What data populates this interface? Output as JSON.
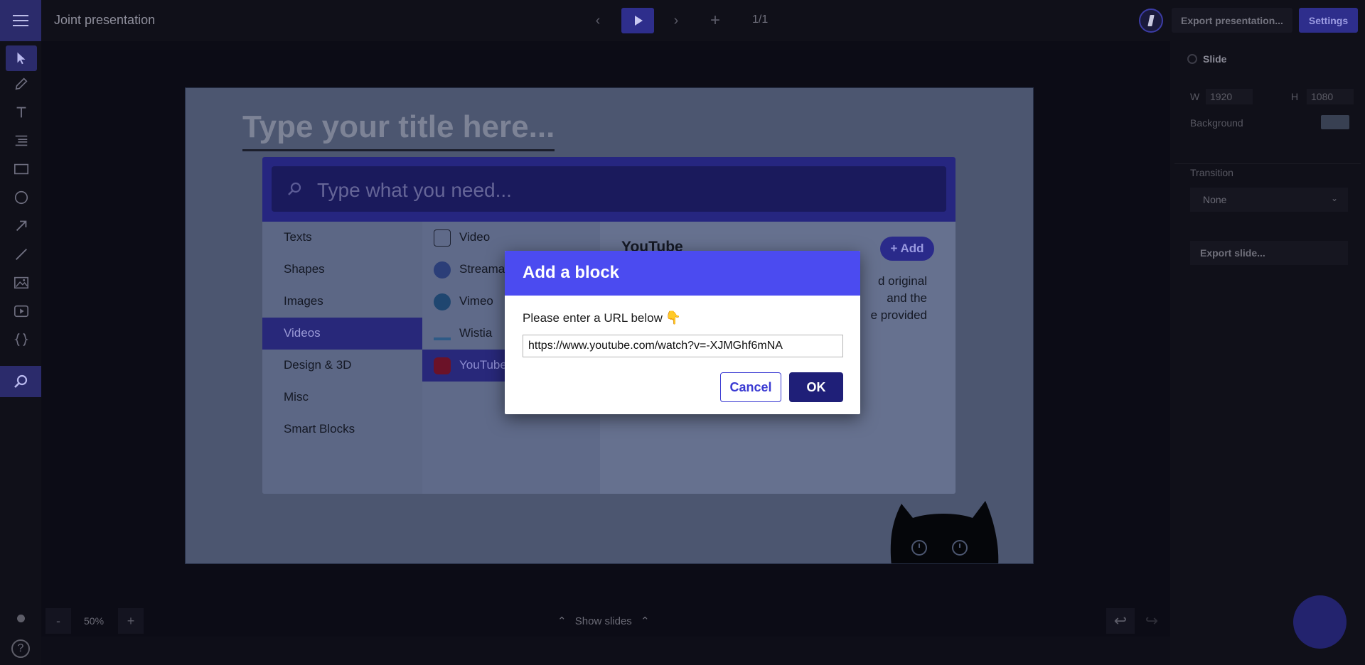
{
  "header": {
    "doc_title": "Joint presentation",
    "page_counter": "1/1",
    "export_label": "Export presentation...",
    "settings_label": "Settings"
  },
  "slide": {
    "title_placeholder": "Type your title here..."
  },
  "palette": {
    "search_placeholder": "Type what you need...",
    "categories": [
      "Texts",
      "Shapes",
      "Images",
      "Videos",
      "Design & 3D",
      "Misc",
      "Smart Blocks"
    ],
    "active_category": "Videos",
    "sub_items": [
      "Video",
      "Streama",
      "Vimeo",
      "Wistia",
      "YouTube"
    ],
    "active_sub_item": "YouTube",
    "detail": {
      "title": "YouTube",
      "add_label": "+ Add",
      "desc_line1": "d original",
      "desc_line2": "and the",
      "desc_line3": "e provided"
    }
  },
  "right_panel": {
    "section_title": "Slide",
    "width_label": "W",
    "width_value": "1920",
    "height_label": "H",
    "height_value": "1080",
    "background_label": "Background",
    "transition_label": "Transition",
    "transition_value": "None",
    "export_slide_label": "Export slide..."
  },
  "bottom": {
    "zoom_minus": "-",
    "zoom_level": "50%",
    "zoom_plus": "+",
    "show_slides_label": "Show slides"
  },
  "modal": {
    "title": "Add a block",
    "prompt": "Please enter a URL below",
    "url_value": "https://www.youtube.com/watch?v=-XJMGhf6mNA",
    "cancel_label": "Cancel",
    "ok_label": "OK"
  },
  "colors": {
    "accent": "#4b4bf0",
    "ok_button": "#1f1f78",
    "toolbar_active": "#2b2b6b"
  }
}
